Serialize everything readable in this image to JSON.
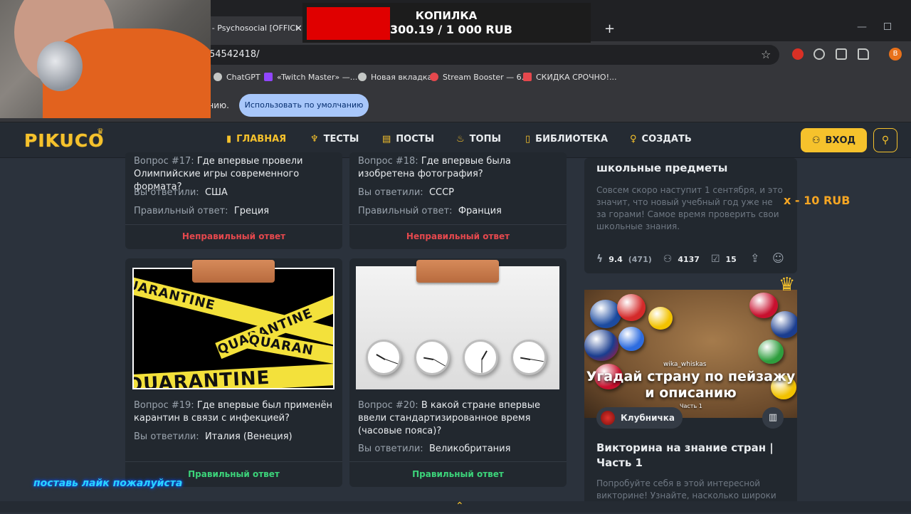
{
  "browser": {
    "active_tab_title": "t - Psychosocial [OFFICI",
    "url": "54542418/",
    "bookmarks": [
      {
        "label": "ChatGPT",
        "color": "#c4c7c5"
      },
      {
        "label": "«Twitch Master» —...",
        "color": "#9146ff"
      },
      {
        "label": "Новая вкладка",
        "color": "#c4c7c5"
      },
      {
        "label": "Stream Booster — 6...",
        "color": "#e5484d"
      },
      {
        "label": "СКИДКА СРОЧНО!...",
        "color": "#e5484d"
      }
    ],
    "infobar_text": "анию.",
    "default_button_label": "Использовать по умолчанию",
    "profile_initial": "B"
  },
  "site": {
    "logo": "PIKUCO",
    "nav": [
      {
        "label": "ГЛАВНАЯ",
        "icon": "bookmark-icon",
        "active": true
      },
      {
        "label": "ТЕСТЫ",
        "icon": "trophy-icon"
      },
      {
        "label": "ПОСТЫ",
        "icon": "document-icon"
      },
      {
        "label": "ТОПЫ",
        "icon": "fire-icon"
      },
      {
        "label": "БИБЛИОТЕКА",
        "icon": "book-icon"
      },
      {
        "label": "СОЗДАТЬ",
        "icon": "lightbulb-icon"
      }
    ],
    "login_label": "ВХОД",
    "colors": {
      "accent": "#f6c22c",
      "wrong": "#e5484d",
      "right": "#3cd47a"
    }
  },
  "results": {
    "answered_label": "Вы ответили:",
    "correct_label": "Правильный ответ:",
    "q17": {
      "number": "Вопрос #17:",
      "question": "Где впервые провели Олимпийские игры современного формата?",
      "answered": "США",
      "correct": "Греция",
      "verdict": "Неправильный ответ"
    },
    "q18": {
      "number": "Вопрос #18:",
      "question": "Где впервые была изобретена фотография?",
      "answered": "СССР",
      "correct": "Франция",
      "verdict": "Неправильный ответ"
    },
    "q19": {
      "number": "Вопрос #19:",
      "question": "Где впервые был применён карантин в связи с инфекцией?",
      "answered": "Италия (Венеция)",
      "verdict": "Правильный ответ",
      "image_words": [
        "QUARANTINE",
        "QUARANTINE",
        "QUARAN",
        "QUARANTINE"
      ]
    },
    "q20": {
      "number": "Вопрос #20:",
      "question": "В какой стране впервые ввели стандартизированное время (часовые пояса)?",
      "answered": "Великобритания",
      "verdict": "Правильный ответ"
    }
  },
  "sidebar": {
    "card1": {
      "title": "школьные предметы",
      "description": "Совсем скоро наступит 1 сентября, и это значит, что новый учебный год уже не за горами! Самое время проверить свои школьные знания.",
      "rating": "9.4",
      "votes": "(471)",
      "plays": "4137",
      "questions": "15"
    },
    "card2": {
      "image_title": "Угадай страну по пейзажу и описанию",
      "image_author": "wika_whiskas",
      "image_part": "Часть 1",
      "author": "Клубничка",
      "title": "Викторина на знание стран | Часть 1",
      "description": "Попробуйте себя в этой интересной викторине! Узнайте, насколько широки ваши знания о странах мира и сможете"
    }
  },
  "overlay": {
    "kopilka_title": "КОПИЛКА",
    "kopilka_amount": "300.19 / 1 000 RUB",
    "bonus": "x - 10 RUB",
    "like_prompt": "поставь лайк пожалуйста"
  }
}
